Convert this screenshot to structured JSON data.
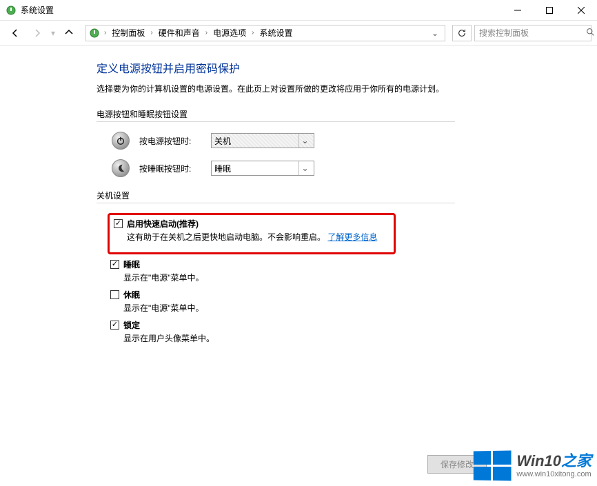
{
  "titlebar": {
    "title": "系统设置"
  },
  "breadcrumb": {
    "items": [
      "控制面板",
      "硬件和声音",
      "电源选项",
      "系统设置"
    ]
  },
  "search": {
    "placeholder": "搜索控制面板"
  },
  "page": {
    "heading": "定义电源按钮并启用密码保护",
    "subtext": "选择要为你的计算机设置的电源设置。在此页上对设置所做的更改将应用于你所有的电源计划。"
  },
  "section_buttons": {
    "legend": "电源按钮和睡眠按钮设置",
    "power_label": "按电源按钮时:",
    "power_value": "关机",
    "sleep_label": "按睡眠按钮时:",
    "sleep_value": "睡眠"
  },
  "section_shutdown": {
    "legend": "关机设置",
    "fast_startup": {
      "title": "启用快速启动(推荐)",
      "desc_prefix": "这有助于在关机之后更快地启动电脑。不会影响重启。",
      "link": "了解更多信息",
      "checked": true
    },
    "sleep": {
      "title": "睡眠",
      "desc": "显示在\"电源\"菜单中。",
      "checked": true
    },
    "hibernate": {
      "title": "休眠",
      "desc": "显示在\"电源\"菜单中。",
      "checked": false
    },
    "lock": {
      "title": "锁定",
      "desc": "显示在用户头像菜单中。",
      "checked": true
    }
  },
  "footer": {
    "save_label": "保存修改"
  },
  "watermark": {
    "main1": "Win10",
    "main2": "之家",
    "url": "www.win10xitong.com"
  }
}
